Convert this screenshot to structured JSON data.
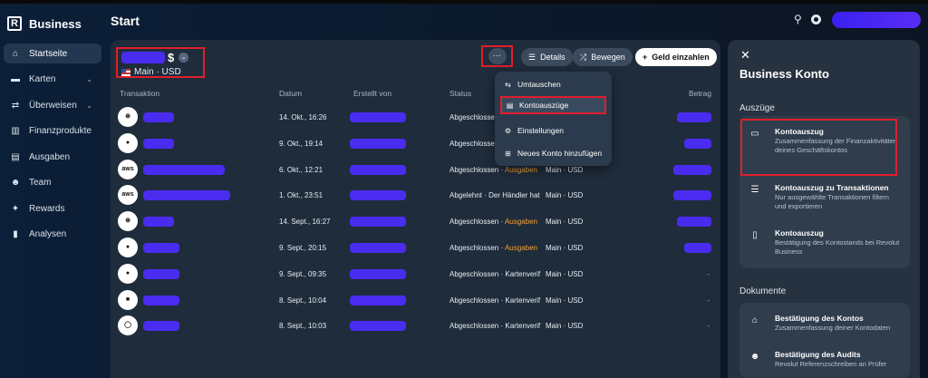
{
  "brand": {
    "name": "Business",
    "logo": "R"
  },
  "sidebar": {
    "items": [
      {
        "label": "Startseite",
        "icon": "home-icon",
        "active": true,
        "chevron": false
      },
      {
        "label": "Karten",
        "icon": "card-icon",
        "active": false,
        "chevron": true
      },
      {
        "label": "Überweisen",
        "icon": "transfer-icon",
        "active": false,
        "chevron": true
      },
      {
        "label": "Finanzprodukte",
        "icon": "chart-icon",
        "active": false,
        "chevron": false
      },
      {
        "label": "Ausgaben",
        "icon": "receipt-icon",
        "active": false,
        "chevron": false
      },
      {
        "label": "Team",
        "icon": "team-icon",
        "active": false,
        "chevron": false
      },
      {
        "label": "Rewards",
        "icon": "rewards-icon",
        "active": false,
        "chevron": false
      },
      {
        "label": "Analysen",
        "icon": "analytics-icon",
        "active": false,
        "chevron": false
      }
    ]
  },
  "header": {
    "title": "Start"
  },
  "account": {
    "currency_symbol": "$",
    "name": "Main · USD"
  },
  "actions": {
    "more": "···",
    "details": "Details",
    "move": "Bewegen",
    "deposit": "Geld einzahlen"
  },
  "table": {
    "headers": {
      "transaction": "Transaktion",
      "date": "Datum",
      "created_by": "Erstellt von",
      "status": "Status",
      "amount": "Betrag"
    },
    "rows": [
      {
        "icon": "openai-icon",
        "icon_text": "⊛",
        "date": "14. Okt., 16:26",
        "status": "Abgeschlossen",
        "warn": "",
        "account": "",
        "name_w": 34,
        "amt_w": 38,
        "amount_dash": false
      },
      {
        "icon": "github-icon",
        "icon_text": "●",
        "date": "9. Okt., 19:14",
        "status": "Abgeschlossen",
        "warn": "",
        "account": "",
        "name_w": 34,
        "amt_w": 30,
        "amount_dash": false
      },
      {
        "icon": "aws-icon",
        "icon_text": "aws",
        "date": "6. Okt., 12:21",
        "status": "Abgeschlossen · ",
        "warn": "Ausgaben",
        "account": "Main · USD",
        "name_w": 90,
        "amt_w": 42,
        "amount_dash": false
      },
      {
        "icon": "aws-icon",
        "icon_text": "aws",
        "date": "1. Okt., 23:51",
        "status": "Abgelehnt · Der Händler hat",
        "warn": "",
        "account": "Main · USD",
        "name_w": 96,
        "amt_w": 42,
        "amount_dash": false
      },
      {
        "icon": "openai-icon",
        "icon_text": "⊛",
        "date": "14. Sept., 16:27",
        "status": "Abgeschlossen · ",
        "warn": "Ausgaben",
        "account": "Main · USD",
        "name_w": 34,
        "amt_w": 38,
        "amount_dash": false
      },
      {
        "icon": "github-icon",
        "icon_text": "●",
        "date": "9. Sept., 20:15",
        "status": "Abgeschlossen · ",
        "warn": "Ausgaben",
        "account": "Main · USD",
        "name_w": 40,
        "amt_w": 30,
        "amount_dash": false
      },
      {
        "icon": "github-icon",
        "icon_text": "●",
        "date": "9. Sept., 09:35",
        "status": "Abgeschlossen · Kartenverif",
        "warn": "",
        "account": "Main · USD",
        "name_w": 40,
        "amt_w": 0,
        "amount_dash": true
      },
      {
        "icon": "bank-logo-icon",
        "icon_text": "■",
        "date": "8. Sept., 10:04",
        "status": "Abgeschlossen · Kartenverif",
        "warn": "",
        "account": "Main · USD",
        "name_w": 40,
        "amt_w": 0,
        "amount_dash": true
      },
      {
        "icon": "circle-logo-icon",
        "icon_text": "◯",
        "date": "8. Sept., 10:03",
        "status": "Abgeschlossen · Kartenverif",
        "warn": "",
        "account": "Main · USD",
        "name_w": 40,
        "amt_w": 0,
        "amount_dash": true
      }
    ]
  },
  "menu": {
    "items": [
      {
        "label": "Umtauschen",
        "icon": "exchange-icon",
        "highlight": false
      },
      {
        "label": "Kontoauszüge",
        "icon": "statement-icon",
        "highlight": true
      },
      {
        "label": "Einstellungen",
        "icon": "settings-icon",
        "highlight": false
      },
      {
        "label": "Neues Konto hinzufügen",
        "icon": "add-account-icon",
        "highlight": false
      }
    ]
  },
  "right_panel": {
    "title": "Business Konto",
    "section_statements": "Auszüge",
    "statements": [
      {
        "title": "Kontoauszug",
        "desc": "Zusammenfassung der Finanzaktivitäten deines Geschäftskontos",
        "icon": "calendar-icon"
      },
      {
        "title": "Kontoauszug zu Transaktionen",
        "desc": "Nur ausgewählte Transaktionen filtern und exportieren",
        "icon": "filter-list-icon"
      },
      {
        "title": "Kontoauszug",
        "desc": "Bestätigung des Kontostands bei Revolut Business",
        "icon": "document-icon"
      }
    ],
    "section_documents": "Dokumente",
    "documents": [
      {
        "title": "Bestätigung des Kontos",
        "desc": "Zusammenfassung deiner Kontodaten",
        "icon": "bank-icon"
      },
      {
        "title": "Bestätigung des Audits",
        "desc": "Revolut Referenzschreiben an Prüfer",
        "icon": "people-icon"
      }
    ]
  },
  "colors": {
    "highlight": "#e01e2b",
    "redaction": "#4a2cf0",
    "warning": "#f2a23a"
  }
}
